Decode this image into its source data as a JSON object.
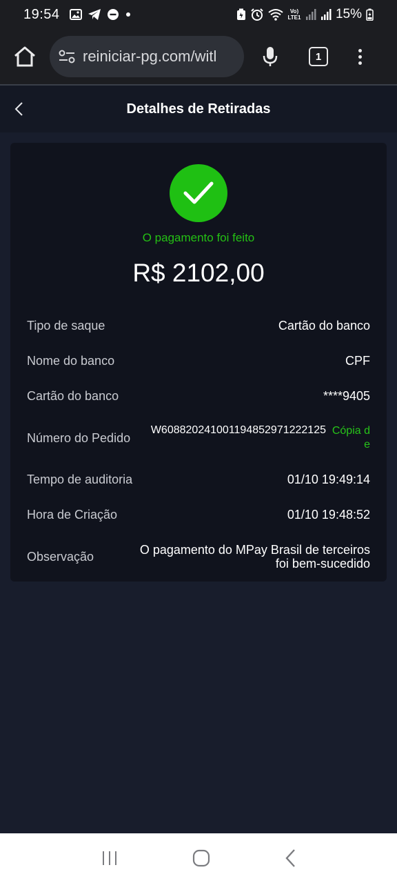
{
  "status_bar": {
    "time": "19:54",
    "battery": "15%",
    "network_label": "Vo) LTE1"
  },
  "browser": {
    "url": "reiniciar-pg.com/witl",
    "tab_count": "1"
  },
  "header": {
    "title": "Detalhes de Retiradas"
  },
  "payment": {
    "status_text": "O pagamento foi feito",
    "amount": "R$ 2102,00",
    "status_color": "#1fc013"
  },
  "details": {
    "withdrawal_type": {
      "label": "Tipo de saque",
      "value": "Cartão do banco"
    },
    "bank_name": {
      "label": "Nome do banco",
      "value": "CPF"
    },
    "bank_card": {
      "label": "Cartão do banco",
      "value": "****9405"
    },
    "order_number": {
      "label": "Número do Pedido",
      "value": "W6088202410011948529712221​25",
      "copy_label": "Cópia de"
    },
    "audit_time": {
      "label": "Tempo de auditoria",
      "value": "01/10 19:49:14"
    },
    "creation_time": {
      "label": "Hora de Criação",
      "value": "01/10 19:48:52"
    },
    "observation": {
      "label": "Observação",
      "value_line1": "O pagamento do MPay Brasil de terceiros",
      "value_line2": "foi bem-sucedido"
    }
  }
}
